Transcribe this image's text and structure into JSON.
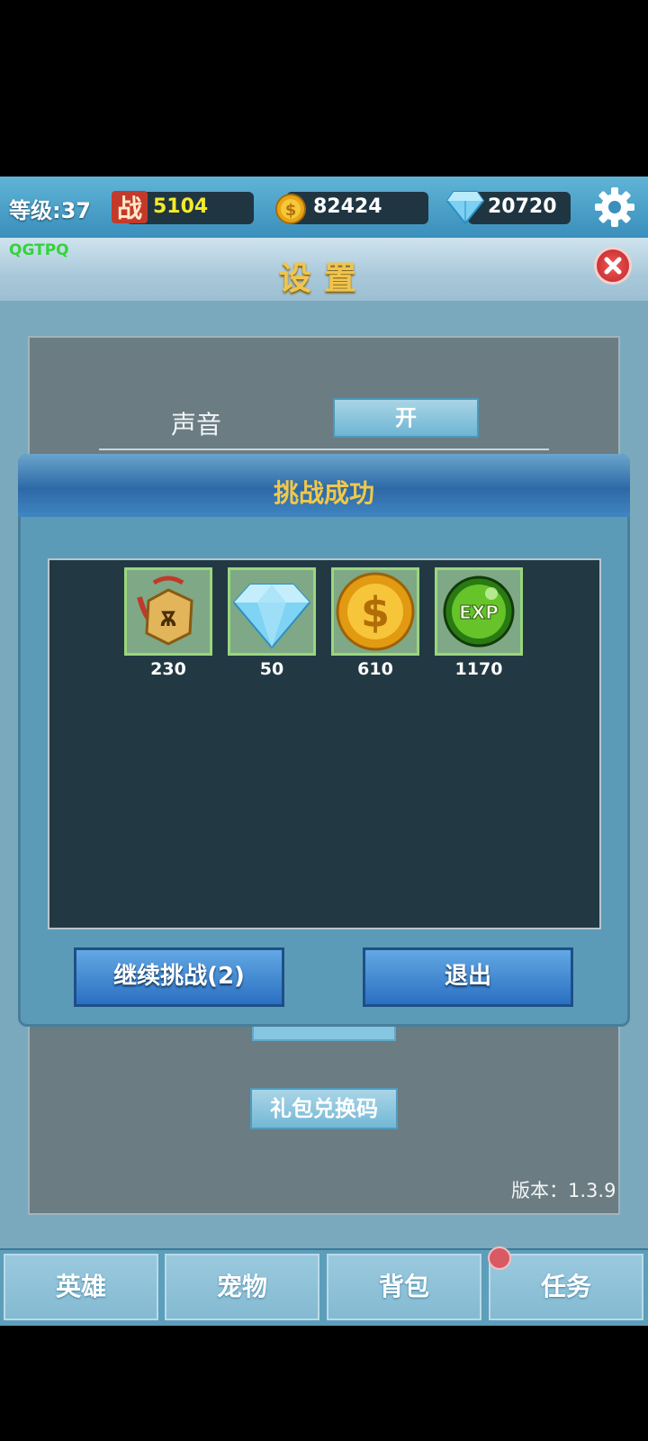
{
  "topbar": {
    "level": "等级:37",
    "power_icon_text": "战",
    "power": "5104",
    "gold": "82424",
    "diamonds": "20720"
  },
  "settings": {
    "title": "设置",
    "code_tag": "QGTPQ",
    "sound_label": "声音",
    "sound_value": "开",
    "gift_code_label": "礼包兑换码",
    "version": "版本：1.3.9"
  },
  "popup": {
    "title": "挑战成功",
    "rewards": [
      {
        "icon": "medal-token-icon",
        "count": "230"
      },
      {
        "icon": "diamond-icon",
        "count": "50"
      },
      {
        "icon": "gold-coin-icon",
        "count": "610"
      },
      {
        "icon": "exp-orb-icon",
        "count": "1170"
      }
    ],
    "continue_label": "继续挑战(2)",
    "exit_label": "退出"
  },
  "nav": {
    "tabs": [
      {
        "label": "英雄"
      },
      {
        "label": "宠物"
      },
      {
        "label": "背包"
      },
      {
        "label": "任务"
      }
    ]
  },
  "colors": {
    "accent_gold": "#f0c84a",
    "panel_blue": "#5c9bb7",
    "content_dark": "#223944"
  }
}
